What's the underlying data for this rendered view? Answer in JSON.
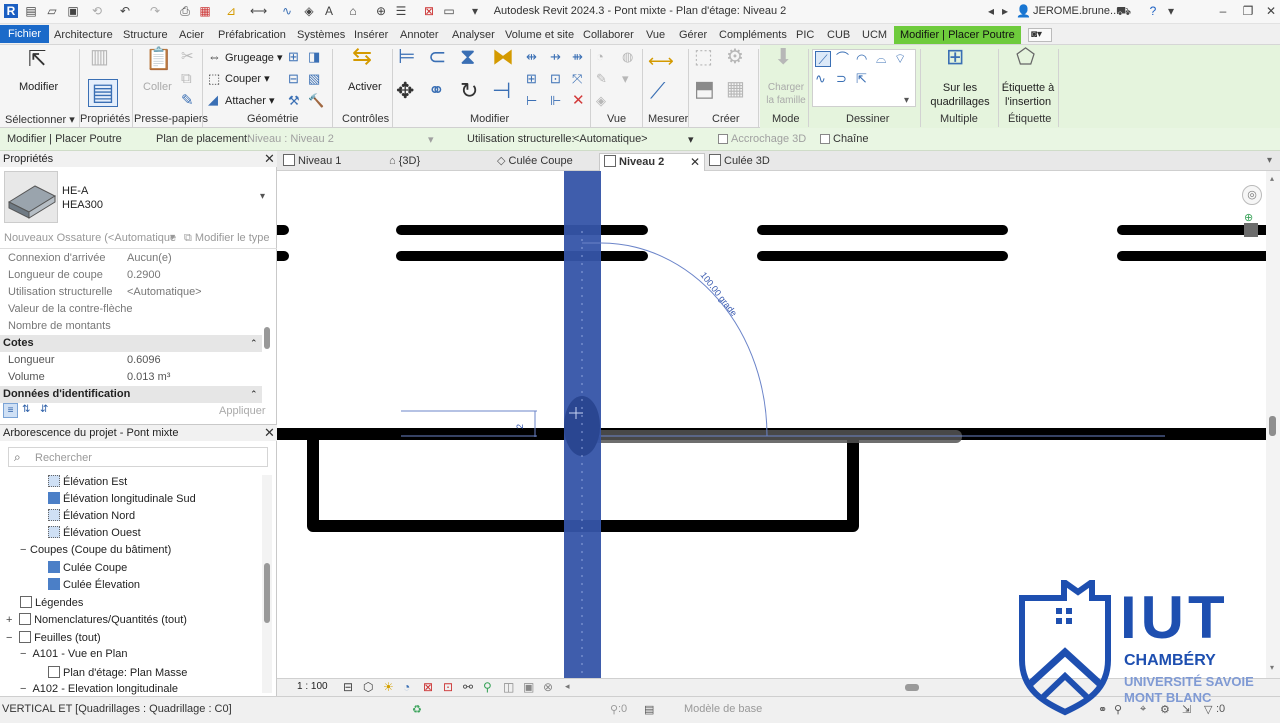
{
  "title": "Autodesk Revit 2024.3 - Pont mixte - Plan d'étage: Niveau 2",
  "user": "JEROME.brune...",
  "tabs": [
    "Fichier",
    "Architecture",
    "Structure",
    "Acier",
    "Préfabrication",
    "Systèmes",
    "Insérer",
    "Annoter",
    "Analyser",
    "Volume et site",
    "Collaborer",
    "Vue",
    "Gérer",
    "Compléments",
    "PIC",
    "CUB",
    "UCM",
    "Modifier | Placer Poutre"
  ],
  "ribbon": {
    "modify_label": "Modifier",
    "select_label": "Sélectionner",
    "properties_label": "Propriétés",
    "clipboard_label": "Presse-papiers",
    "coller_label": "Coller",
    "grugeage": "Grugeage",
    "couper": "Couper",
    "attacher": "Attacher",
    "geometry_label": "Géométrie",
    "activer": "Activer",
    "controls_label": "Contrôles",
    "modifier_label": "Modifier",
    "vue_label": "Vue",
    "mesurer_label": "Mesurer",
    "creer_label": "Créer",
    "charger_label": "Charger la famille",
    "mode_label": "Mode",
    "dessiner_label": "Dessiner",
    "sur_label": "Sur les quadrillages",
    "multiple_label": "Multiple",
    "etiquette_btn": "Étiquette à l'insertion",
    "etiquette_label": "Étiquette"
  },
  "options": {
    "context": "Modifier | Placer Poutre",
    "plan_label": "Plan de placement:",
    "plan_value": "Niveau : Niveau 2",
    "usage_label": "Utilisation structurelle:",
    "usage_value": "<Automatique>",
    "accrochage": "Accrochage 3D",
    "chaine": "Chaîne"
  },
  "properties": {
    "title": "Propriétés",
    "family": "HE-A",
    "type": "HEA300",
    "instance_filter": "Nouveaux Ossature (<Automatique",
    "edit_type": "Modifier le type",
    "rows": [
      {
        "k": "Connexion d'arrivée",
        "v": "Aucun(e)"
      },
      {
        "k": "Longueur de coupe",
        "v": "0.2900"
      },
      {
        "k": "Utilisation structurelle",
        "v": "<Automatique>"
      },
      {
        "k": "Valeur de la contre-flèche",
        "v": ""
      },
      {
        "k": "Nombre de montants",
        "v": ""
      }
    ],
    "group_cotes": "Cotes",
    "cotes_rows": [
      {
        "k": "Longueur",
        "v": "0.6096"
      },
      {
        "k": "Volume",
        "v": "0.013 m³"
      }
    ],
    "group_ident": "Données d'identification",
    "apply": "Appliquer"
  },
  "browser": {
    "title": "Arborescence du projet - Pont mixte",
    "search_placeholder": "Rechercher",
    "items": [
      "Élévation Est",
      "Élévation longitudinale Sud",
      "Élévation Nord",
      "Élévation Ouest",
      "Coupes (Coupe du bâtiment)",
      "Culée Coupe",
      "Culée Élevation",
      "Légendes",
      "Nomenclatures/Quantités (tout)",
      "Feuilles (tout)",
      "A101 - Vue en Plan",
      "Plan d'étage: Plan Masse",
      "A102 - Elevation longitudinale"
    ]
  },
  "view_tabs": [
    "Niveau 1",
    "{3D}",
    "Culée Coupe",
    "Niveau 2",
    "Culée 3D"
  ],
  "canvas": {
    "angle_label": "100.00 grade",
    "dim_label": "2"
  },
  "viewbar": {
    "scale": "1 : 100"
  },
  "status": {
    "left": "VERTICAL ET [Quadrillages : Quadrillage : C0]",
    "zero1": ":0",
    "model": "Modèle de base",
    "zero2": ":0"
  },
  "logo": {
    "iut": "IUT",
    "city": "CHAMBÉRY",
    "univ1": "UNIVERSITÉ SAVOIE",
    "univ2": "MONT BLANC",
    "color": "#1e4fb0"
  },
  "colors": {
    "file_tab": "#1b6ac9",
    "context_tab": "#6ecb3c",
    "beam": "#3554a8"
  }
}
